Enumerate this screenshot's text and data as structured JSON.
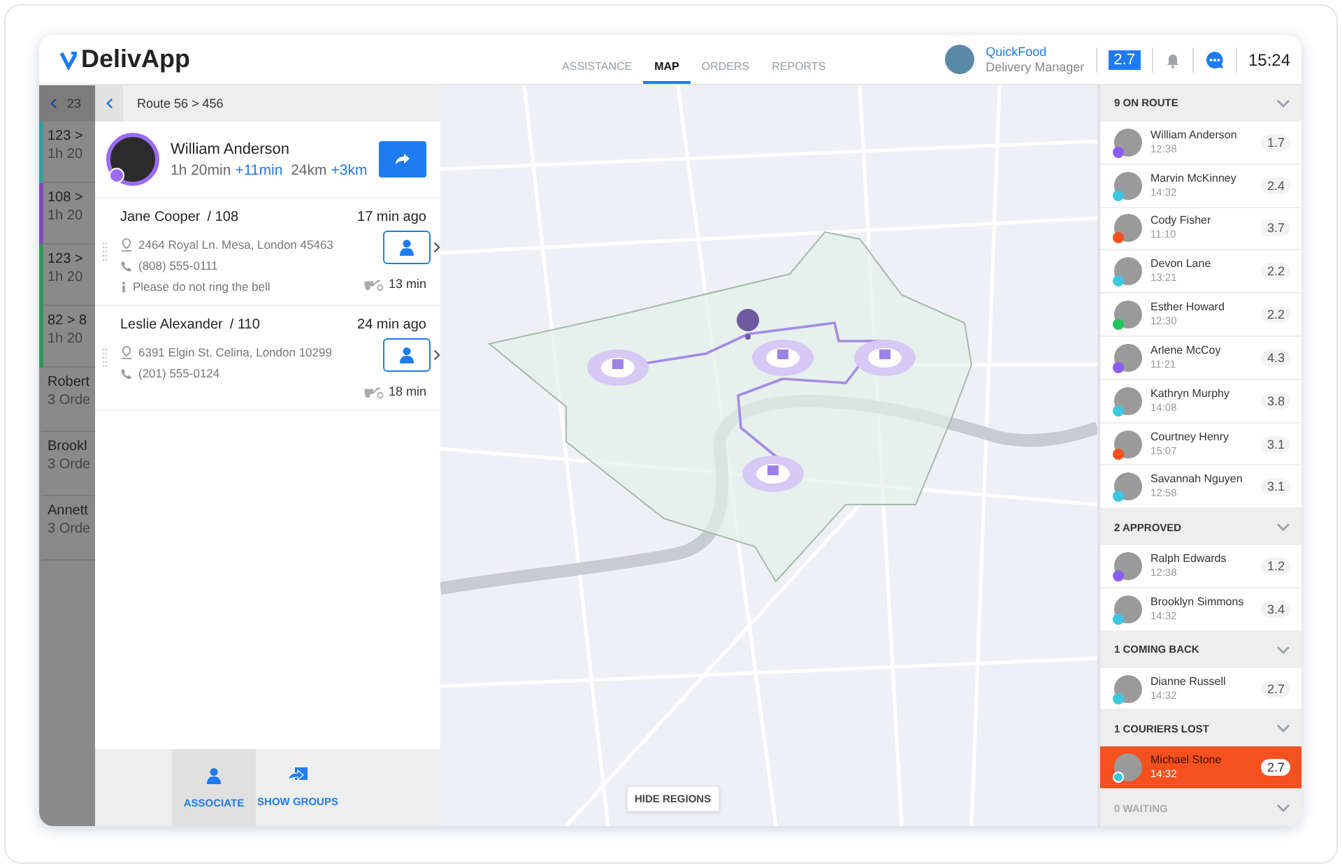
{
  "header": {
    "logo": "DelivApp",
    "tabs": [
      {
        "label": "ASSISTANCE",
        "selected": false
      },
      {
        "label": "MAP",
        "selected": true
      },
      {
        "label": "ORDERS",
        "selected": false
      },
      {
        "label": "REPORTS",
        "selected": false
      }
    ],
    "account": {
      "company": "QuickFood",
      "role": "Delivery Manager"
    },
    "rating": "2.7",
    "time": "15:24"
  },
  "back_list": {
    "title": "23",
    "items": [
      {
        "title": "123 >",
        "subtitle": "1h 20",
        "color": "#3a9e9a"
      },
      {
        "title": "108 >",
        "subtitle": "1h 20",
        "color": "#7c4dbb"
      },
      {
        "title": "123 >",
        "subtitle": "1h 20",
        "color": "#2e9a5a"
      },
      {
        "title": "82 > 8",
        "subtitle": "1h 20",
        "color": "#2e9a5a"
      },
      {
        "title": "Robert",
        "subtitle": "3 Orde"
      },
      {
        "title": "Brookl",
        "subtitle": "3 Orde"
      },
      {
        "title": "Annett",
        "subtitle": "3 Orde"
      }
    ]
  },
  "route_panel": {
    "breadcrumb": "Route 56 > 456",
    "courier": {
      "name": "William Anderson",
      "duration": "1h 20min",
      "duration_delta": "+11min",
      "distance": "24km",
      "distance_delta": "+3km"
    },
    "orders": [
      {
        "name": "Jane Cooper",
        "number": "/ 108",
        "age": "17 min ago",
        "address": "2464 Royal Ln. Mesa, London 45463",
        "phone": "(808) 555-0111",
        "note": "Please do not ring the bell",
        "eta": "13 min"
      },
      {
        "name": "Leslie Alexander",
        "number": "/ 110",
        "age": "24 min ago",
        "address": "6391 Elgin St. Celina, London 10299",
        "phone": "(201) 555-0124",
        "eta": "18 min"
      }
    ],
    "actions": [
      {
        "label": "ASSOCIATE",
        "kind": "associate",
        "selected": true
      },
      {
        "label": "SHOW GROUPS",
        "kind": "groups",
        "selected": false
      }
    ]
  },
  "map": {
    "hide_button": "HIDE REGIONS"
  },
  "groups": [
    {
      "title": "9 ON ROUTE",
      "muted": false,
      "couriers": [
        {
          "name": "William Anderson",
          "time": "12:38",
          "rating": "1.7",
          "color": "#8b5cf6",
          "highlighted": false
        },
        {
          "name": "Marvin McKinney",
          "time": "14:32",
          "rating": "2.4",
          "color": "#3cc8e0",
          "highlighted": false
        },
        {
          "name": "Cody Fisher",
          "time": "11:10",
          "rating": "3.7",
          "color": "#f4511e",
          "highlighted": false
        },
        {
          "name": "Devon Lane",
          "time": "13:21",
          "rating": "2.2",
          "color": "#3cc8e0",
          "highlighted": false
        },
        {
          "name": "Esther Howard",
          "time": "12:30",
          "rating": "2.2",
          "color": "#22c55e",
          "highlighted": false
        },
        {
          "name": "Arlene McCoy",
          "time": "11:21",
          "rating": "4.3",
          "color": "#8b5cf6",
          "highlighted": false
        },
        {
          "name": "Kathryn Murphy",
          "time": "14:08",
          "rating": "3.8",
          "color": "#3cc8e0",
          "highlighted": false
        },
        {
          "name": "Courtney Henry",
          "time": "15:07",
          "rating": "3.1",
          "color": "#f4511e",
          "highlighted": false
        },
        {
          "name": "Savannah Nguyen",
          "time": "12:58",
          "rating": "3.1",
          "color": "#3cc8e0",
          "highlighted": false
        }
      ]
    },
    {
      "title": "2 APPROVED",
      "muted": false,
      "couriers": [
        {
          "name": "Ralph Edwards",
          "time": "12:38",
          "rating": "1.2",
          "color": "#8b5cf6",
          "highlighted": false
        },
        {
          "name": "Brooklyn Simmons",
          "time": "14:32",
          "rating": "3.4",
          "color": "#3cc8e0",
          "highlighted": false
        }
      ]
    },
    {
      "title": "1 COMING BACK",
      "muted": false,
      "couriers": [
        {
          "name": "Dianne Russell",
          "time": "14:32",
          "rating": "2.7",
          "color": "#3cc8e0",
          "highlighted": false
        }
      ]
    },
    {
      "title": "1 COURIERS LOST",
      "muted": false,
      "couriers": [
        {
          "name": "Michael Stone",
          "time": "14:32",
          "rating": "2.7",
          "color": "#3cc8e0",
          "highlighted": true
        }
      ]
    },
    {
      "title": "0 WAITING",
      "muted": true
    }
  ]
}
